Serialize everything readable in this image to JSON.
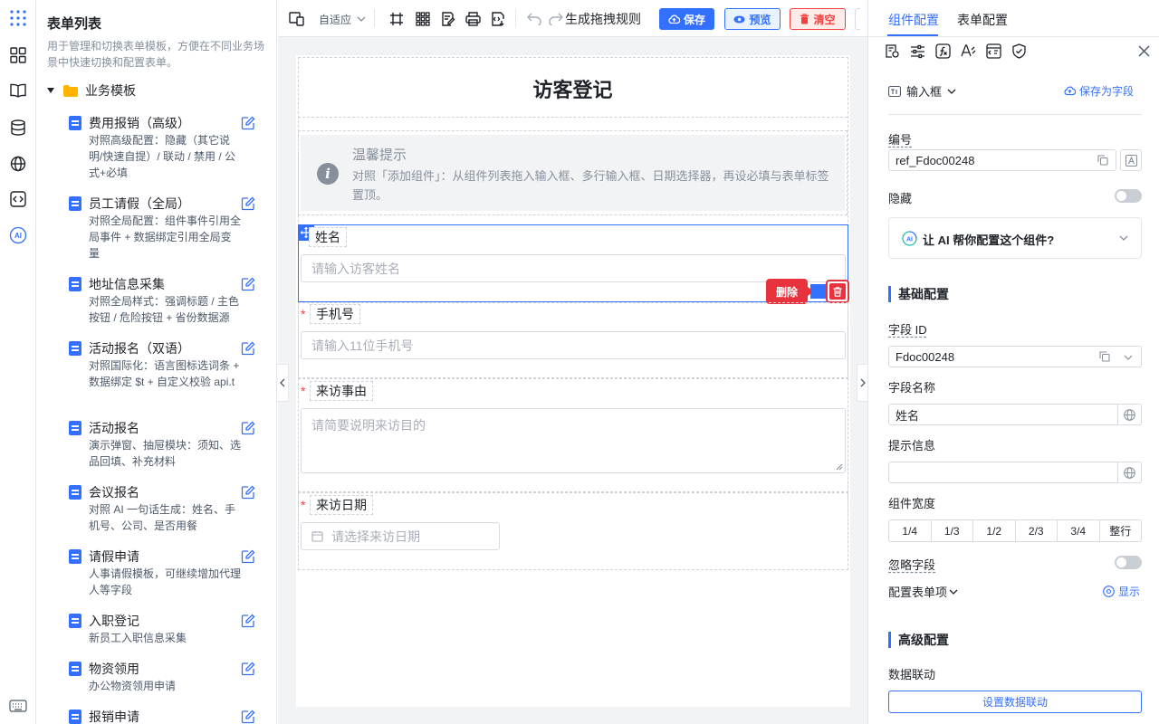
{
  "sidebar": {
    "title": "表单列表",
    "description": "用于管理和切换表单模板，方便在不同业务场景中快速切换和配置表单。",
    "group": "业务模板",
    "items": [
      {
        "name": "费用报销（高级）",
        "desc": "对照高级配置：隐藏（其它说明/快速自提）/ 联动 / 禁用 / 公式+必填"
      },
      {
        "name": "员工请假（全局）",
        "desc": "对照全局配置：组件事件引用全局事件 + 数据绑定引用全局变量"
      },
      {
        "name": "地址信息采集",
        "desc": "对照全局样式：强调标题 / 主色按钮 / 危险按钮 + 省份数据源"
      },
      {
        "name": "活动报名（双语）",
        "desc": "对照国际化：语言图标选词条 + 数据绑定 $t + 自定义校验 api.t"
      },
      {
        "name": "活动报名",
        "desc": "演示弹窗、抽屉模块：须知、选品回填、补充材料"
      },
      {
        "name": "会议报名",
        "desc": "对照 AI 一句话生成：姓名、手机号、公司、是否用餐"
      },
      {
        "name": "请假申请",
        "desc": "人事请假模板，可继续增加代理人等字段"
      },
      {
        "name": "入职登记",
        "desc": "新员工入职信息采集"
      },
      {
        "name": "物资领用",
        "desc": "办公物资领用申请"
      },
      {
        "name": "报销申请",
        "desc": ""
      }
    ]
  },
  "toolbar": {
    "mode": "自适应",
    "rules": "生成拖拽规则",
    "save": "保存",
    "preview": "预览",
    "clear": "清空"
  },
  "form": {
    "title": "访客登记",
    "alert_title": "温馨提示",
    "alert_body": "对照「添加组件」：从组件列表拖入输入框、多行输入框、日期选择器，再设必填与表单标签置顶。",
    "fields": {
      "name_label": "姓名",
      "name_placeholder": "请输入访客姓名",
      "phone_label": "手机号",
      "phone_placeholder": "请输入11位手机号",
      "reason_label": "来访事由",
      "reason_placeholder": "请简要说明来访目的",
      "date_label": "来访日期",
      "date_placeholder": "请选择来访日期"
    },
    "required_mark": "*",
    "delete_tip": "删除"
  },
  "panel": {
    "tab_component": "组件配置",
    "tab_form": "表单配置",
    "component_type": "输入框",
    "save_as_field": "保存为字段",
    "ref_label": "编号",
    "ref_value": "ref_Fdoc00248",
    "hidden_label": "隐藏",
    "ai_prompt": "让 AI 帮你配置这个组件?",
    "basic_section": "基础配置",
    "field_id_label": "字段 ID",
    "field_id_value": "Fdoc00248",
    "field_name_label": "字段名称",
    "field_name_value": "姓名",
    "tip_label": "提示信息",
    "tip_value": "",
    "width_label": "组件宽度",
    "widths": [
      "1/4",
      "1/3",
      "1/2",
      "2/3",
      "3/4",
      "整行"
    ],
    "ignore_label": "忽略字段",
    "config_items_label": "配置表单项",
    "show_label": "显示",
    "advanced_section": "高级配置",
    "linkage_label": "数据联动",
    "linkage_button": "设置数据联动"
  },
  "colors": {
    "primary": "#3370ff",
    "danger": "#e8333f",
    "muted": "#86909c"
  }
}
